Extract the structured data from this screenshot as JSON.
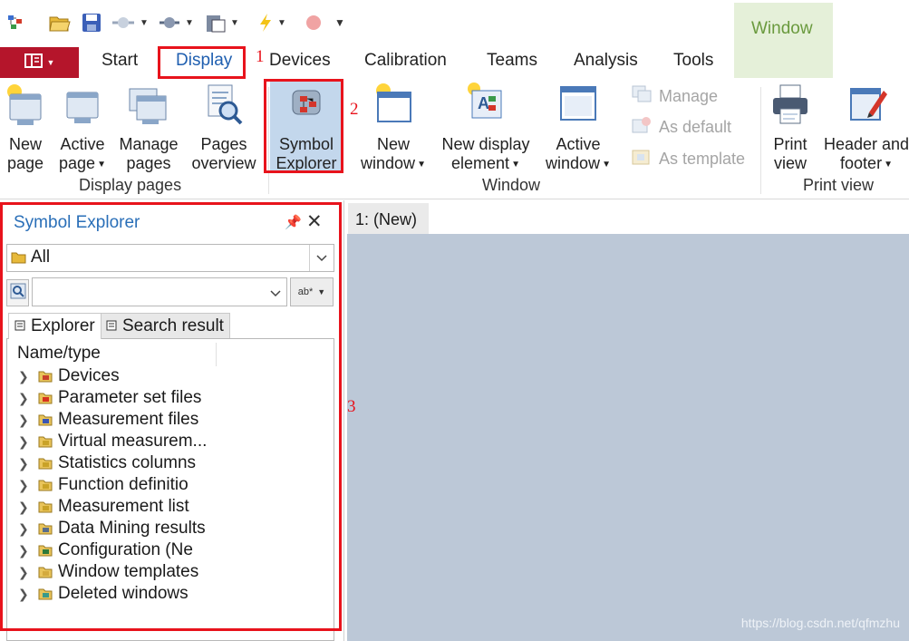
{
  "quick_access": {
    "icons": [
      "app-icon",
      "open-folder-icon",
      "save-icon",
      "network-icon",
      "speaker-icon",
      "clipboard-icon",
      "lightning-icon",
      "record-icon",
      "customize-icon"
    ]
  },
  "tabs": {
    "file_icon": "book-menu-icon",
    "items": [
      "Start",
      "Display",
      "Devices",
      "Calibration",
      "Teams",
      "Analysis",
      "Tools"
    ],
    "context_tab": "Window",
    "active": "Display"
  },
  "ribbon": {
    "display_pages": {
      "label": "Display pages",
      "new_page": [
        "New",
        "page"
      ],
      "active_page": [
        "Active",
        "page"
      ],
      "manage_pages": [
        "Manage",
        "pages"
      ],
      "pages_overview": [
        "Pages",
        "overview"
      ]
    },
    "window": {
      "label": "Window",
      "symbol_explorer": [
        "Symbol",
        "Explorer"
      ],
      "new_window": [
        "New",
        "window"
      ],
      "new_display_element": [
        "New display",
        "element"
      ],
      "active_window": [
        "Active",
        "window"
      ],
      "manage": "Manage",
      "as_default": "As default",
      "as_template": "As template"
    },
    "print_view": {
      "label": "Print view",
      "print_view": [
        "Print",
        "view"
      ],
      "header_footer": [
        "Header and",
        "footer"
      ]
    }
  },
  "annotations": [
    "1",
    "2",
    "3"
  ],
  "panel": {
    "title": "Symbol Explorer",
    "filter_value": "All",
    "search_value": "",
    "search_option": "ab*",
    "tabs": [
      "Explorer",
      "Search result"
    ],
    "column_header": "Name/type",
    "tree_items": [
      {
        "label": "Devices",
        "icon": "devices-folder-icon",
        "color": "#c8402a"
      },
      {
        "label": "Parameter set files",
        "icon": "parameter-file-icon",
        "color": "#d6321f"
      },
      {
        "label": "Measurement files",
        "icon": "measurement-file-icon",
        "color": "#3a56b5"
      },
      {
        "label": "Virtual measurem...",
        "icon": "virtual-measurement-icon",
        "color": "#c9a227"
      },
      {
        "label": "Statistics columns",
        "icon": "statistics-folder-icon",
        "color": "#c9a227"
      },
      {
        "label": "Function definitio",
        "icon": "function-folder-icon",
        "color": "#c9a227"
      },
      {
        "label": "Measurement list",
        "icon": "measurement-list-icon",
        "color": "#c9a227"
      },
      {
        "label": "Data Mining results",
        "icon": "data-mining-icon",
        "color": "#5a6e8a"
      },
      {
        "label": "Configuration (Ne",
        "icon": "configuration-icon",
        "color": "#2f7a3a"
      },
      {
        "label": "Window templates",
        "icon": "window-templates-icon",
        "color": "#d4aa3d"
      },
      {
        "label": "Deleted windows",
        "icon": "recycle-bin-icon",
        "color": "#3a9a8a"
      }
    ]
  },
  "workspace": {
    "tab": "1: (New)",
    "watermark": "https://blog.csdn.net/qfmzhu"
  },
  "colors": {
    "accent_blue": "#2a6fb8",
    "annotation_red": "#e8131c",
    "file_button": "#b5152b",
    "workspace_bg": "#bcc8d7"
  }
}
